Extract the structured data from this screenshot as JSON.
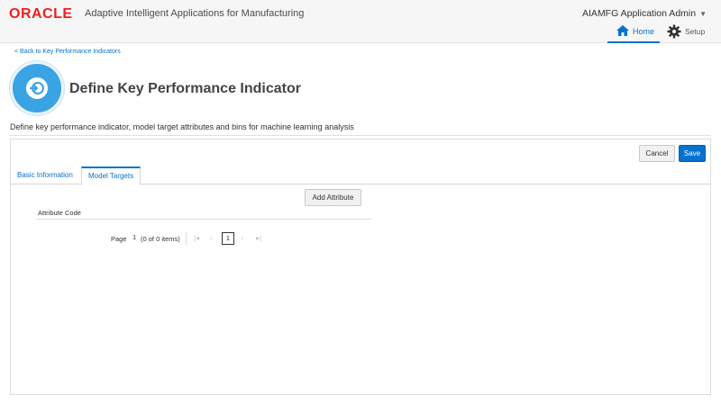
{
  "header": {
    "logo": "ORACLE",
    "app_title": "Adaptive Intelligent Applications for Manufacturing",
    "user": "AIAMFG Application Admin"
  },
  "nav": {
    "home": "Home",
    "setup": "Setup"
  },
  "breadcrumb": {
    "back": "< Back to Key Performance Indicators"
  },
  "page": {
    "title": "Define Key Performance Indicator",
    "description": "Define key performance indicator, model target attributes and bins for machine learning analysis"
  },
  "actions": {
    "cancel": "Cancel",
    "save": "Save"
  },
  "tabs": [
    {
      "label": "Basic Information",
      "selected": false
    },
    {
      "label": "Model Targets",
      "selected": true
    }
  ],
  "model_targets": {
    "add_button": "Add Attribute",
    "columns": [
      "Attribute Code"
    ],
    "rows": []
  },
  "pagination": {
    "label": "Page",
    "page_number": "1",
    "count": "(0 of 0 items)",
    "current_page": "1",
    "icons": {
      "first": "first-page-icon",
      "prev": "previous-page-icon",
      "next": "next-page-icon",
      "last": "last-page-icon"
    }
  },
  "colors": {
    "brand_red": "#ee1f1f",
    "accent_blue": "#0572ce",
    "badge_blue": "#3aa3e3"
  }
}
